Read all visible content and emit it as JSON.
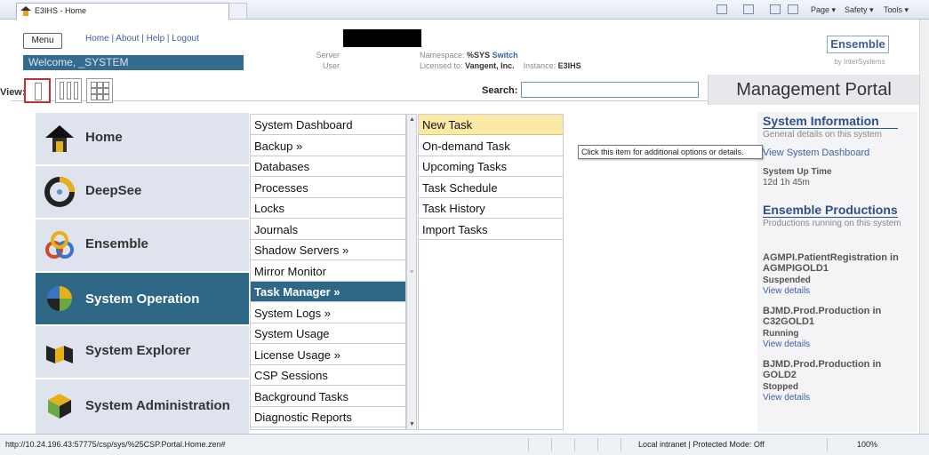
{
  "browser": {
    "tab_title": "E3IHS - Home",
    "cmd_page": "Page ▾",
    "cmd_safety": "Safety ▾",
    "cmd_tools": "Tools ▾"
  },
  "header": {
    "menu_label": "Menu",
    "top_links": "Home | About | Help | Logout",
    "welcome": "Welcome, _SYSTEM",
    "server_label": "Server",
    "user_label": "User",
    "namespace_label": "Namespace:",
    "namespace_value": "%SYS",
    "switch_label": "Switch",
    "licensed_label": "Licensed to:",
    "licensed_value": "Vangent, Inc.",
    "instance_label": "Instance:",
    "instance_value": "E3IHS",
    "logo": "Ensemble",
    "logo_sub": "by InterSystems",
    "view_label": "View:",
    "search_label": "Search:",
    "portal_title": "Management Portal"
  },
  "nav": [
    {
      "label": "Home",
      "icon": "home-icon"
    },
    {
      "label": "DeepSee",
      "icon": "deepsee-icon"
    },
    {
      "label": "Ensemble",
      "icon": "ensemble-icon"
    },
    {
      "label": "System Operation",
      "icon": "system-operation-icon"
    },
    {
      "label": "System Explorer",
      "icon": "system-explorer-icon"
    },
    {
      "label": "System Administration",
      "icon": "system-administration-icon"
    }
  ],
  "col2": [
    "System Dashboard",
    "Backup »",
    "Databases",
    "Processes",
    "Locks",
    "Journals",
    "Shadow Servers »",
    "Mirror Monitor",
    "Task Manager »",
    "System Logs »",
    "System Usage",
    "License Usage »",
    "CSP Sessions",
    "Background Tasks",
    "Diagnostic Reports"
  ],
  "col3": [
    "New Task",
    "On-demand Task",
    "Upcoming Tasks",
    "Task Schedule",
    "Task History",
    "Import Tasks"
  ],
  "tooltip": "Click this item for additional options or details.",
  "side": {
    "sysinfo_title": "System Information",
    "sysinfo_desc": "General details on this system",
    "view_dashboard": "View System Dashboard",
    "uptime_label": "System Up Time",
    "uptime_value": "12d 1h 45m",
    "prod_title": "Ensemble Productions",
    "prod_desc": "Productions running on this system",
    "productions": [
      {
        "name": "AGMPI.PatientRegistration in AGMPIGOLD1",
        "status": "Suspended",
        "link": "View details"
      },
      {
        "name": "BJMD.Prod.Production in C32GOLD1",
        "status": "Running",
        "link": "View details"
      },
      {
        "name": "BJMD.Prod.Production in GOLD2",
        "status": "Stopped",
        "link": "View details"
      }
    ]
  },
  "statusbar": {
    "url": "http://10.24.196.43:57775/csp/sys/%25CSP.Portal.Home.zen#",
    "zone": "Local intranet | Protected Mode: Off",
    "zoom": "100%"
  }
}
